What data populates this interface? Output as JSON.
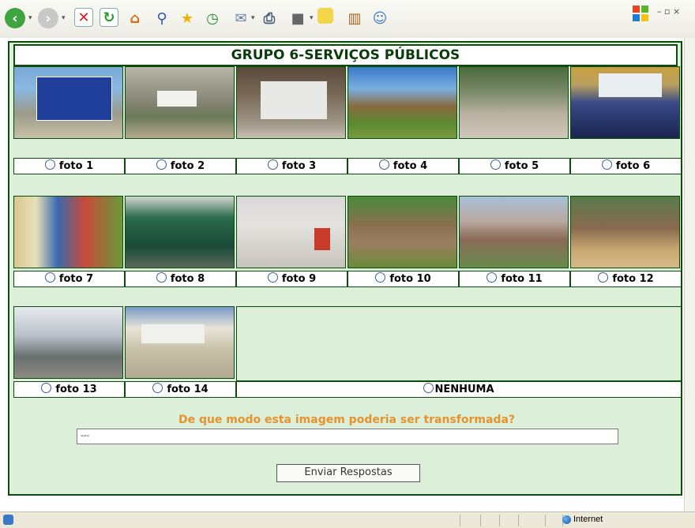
{
  "title": "GRUPO 6-SERVIÇOS PÚBLICOS",
  "photos": [
    {
      "label": "foto 1"
    },
    {
      "label": "foto 2"
    },
    {
      "label": "foto 3"
    },
    {
      "label": "foto 4"
    },
    {
      "label": "foto 5"
    },
    {
      "label": "foto 6"
    },
    {
      "label": "foto 7"
    },
    {
      "label": "foto 8"
    },
    {
      "label": "foto 9"
    },
    {
      "label": "foto 10"
    },
    {
      "label": "foto 11"
    },
    {
      "label": "foto 12"
    },
    {
      "label": "foto 13"
    },
    {
      "label": "foto 14"
    }
  ],
  "none_label": "NENHUMA",
  "question": "De que modo esta imagem poderia ser transformada?",
  "answer_value": "---",
  "submit_label": "Enviar Respostas",
  "status_zone": "Internet",
  "colors": {
    "border": "#0d4a0d",
    "background": "#dcefd9",
    "question": "#e6932e"
  },
  "toolbar_icons": [
    "back-icon",
    "forward-icon",
    "stop-icon",
    "refresh-icon",
    "home-icon",
    "search-icon",
    "favorites-icon",
    "history-icon",
    "mail-icon",
    "print-icon",
    "edit-icon",
    "discuss-icon",
    "research-icon",
    "messenger-icon"
  ]
}
